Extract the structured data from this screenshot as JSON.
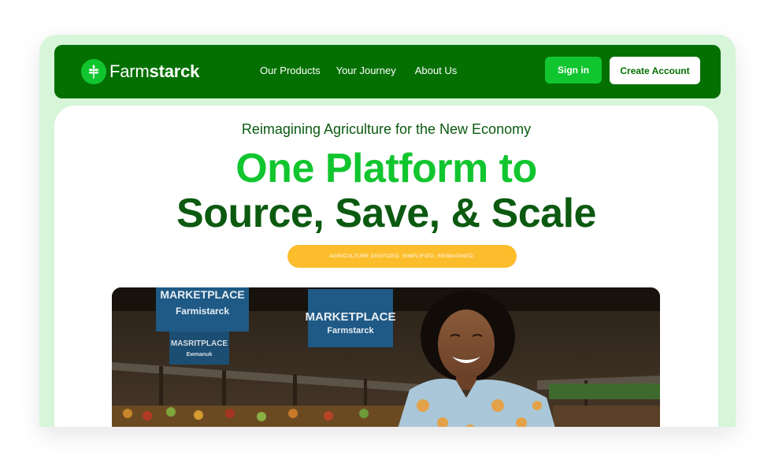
{
  "brand": {
    "name_regular": "Farm",
    "name_bold": "starck",
    "colors": {
      "nav_green": "#047002",
      "accent_green": "#11c52f",
      "dark_green": "#0b5a10",
      "frame_mint": "#d7f5d9",
      "yellow": "#fcbd2d"
    },
    "logo_icon": "wheat-leaf-icon"
  },
  "nav": {
    "links": [
      "Our Products",
      "Your Journey",
      "About Us"
    ],
    "signin_label": "Sign in",
    "create_label": "Create Account"
  },
  "hero": {
    "eyebrow": "Reimagining Agriculture for the New Economy",
    "headline_line1": "One Platform to",
    "headline_line2": "Source, Save, & Scale",
    "tagline": "AGRICULTURE DIGITIZED. SIMPLIFIED. REIMAGINED.",
    "image": {
      "signs": [
        {
          "title": "MARKETPLACE",
          "subtitle": "Farmistarck"
        },
        {
          "title": "MARKETPLACE",
          "subtitle": "Farmstarck"
        },
        {
          "title": "MASRITPLACE",
          "subtitle": "Ewmanuk"
        }
      ]
    }
  }
}
